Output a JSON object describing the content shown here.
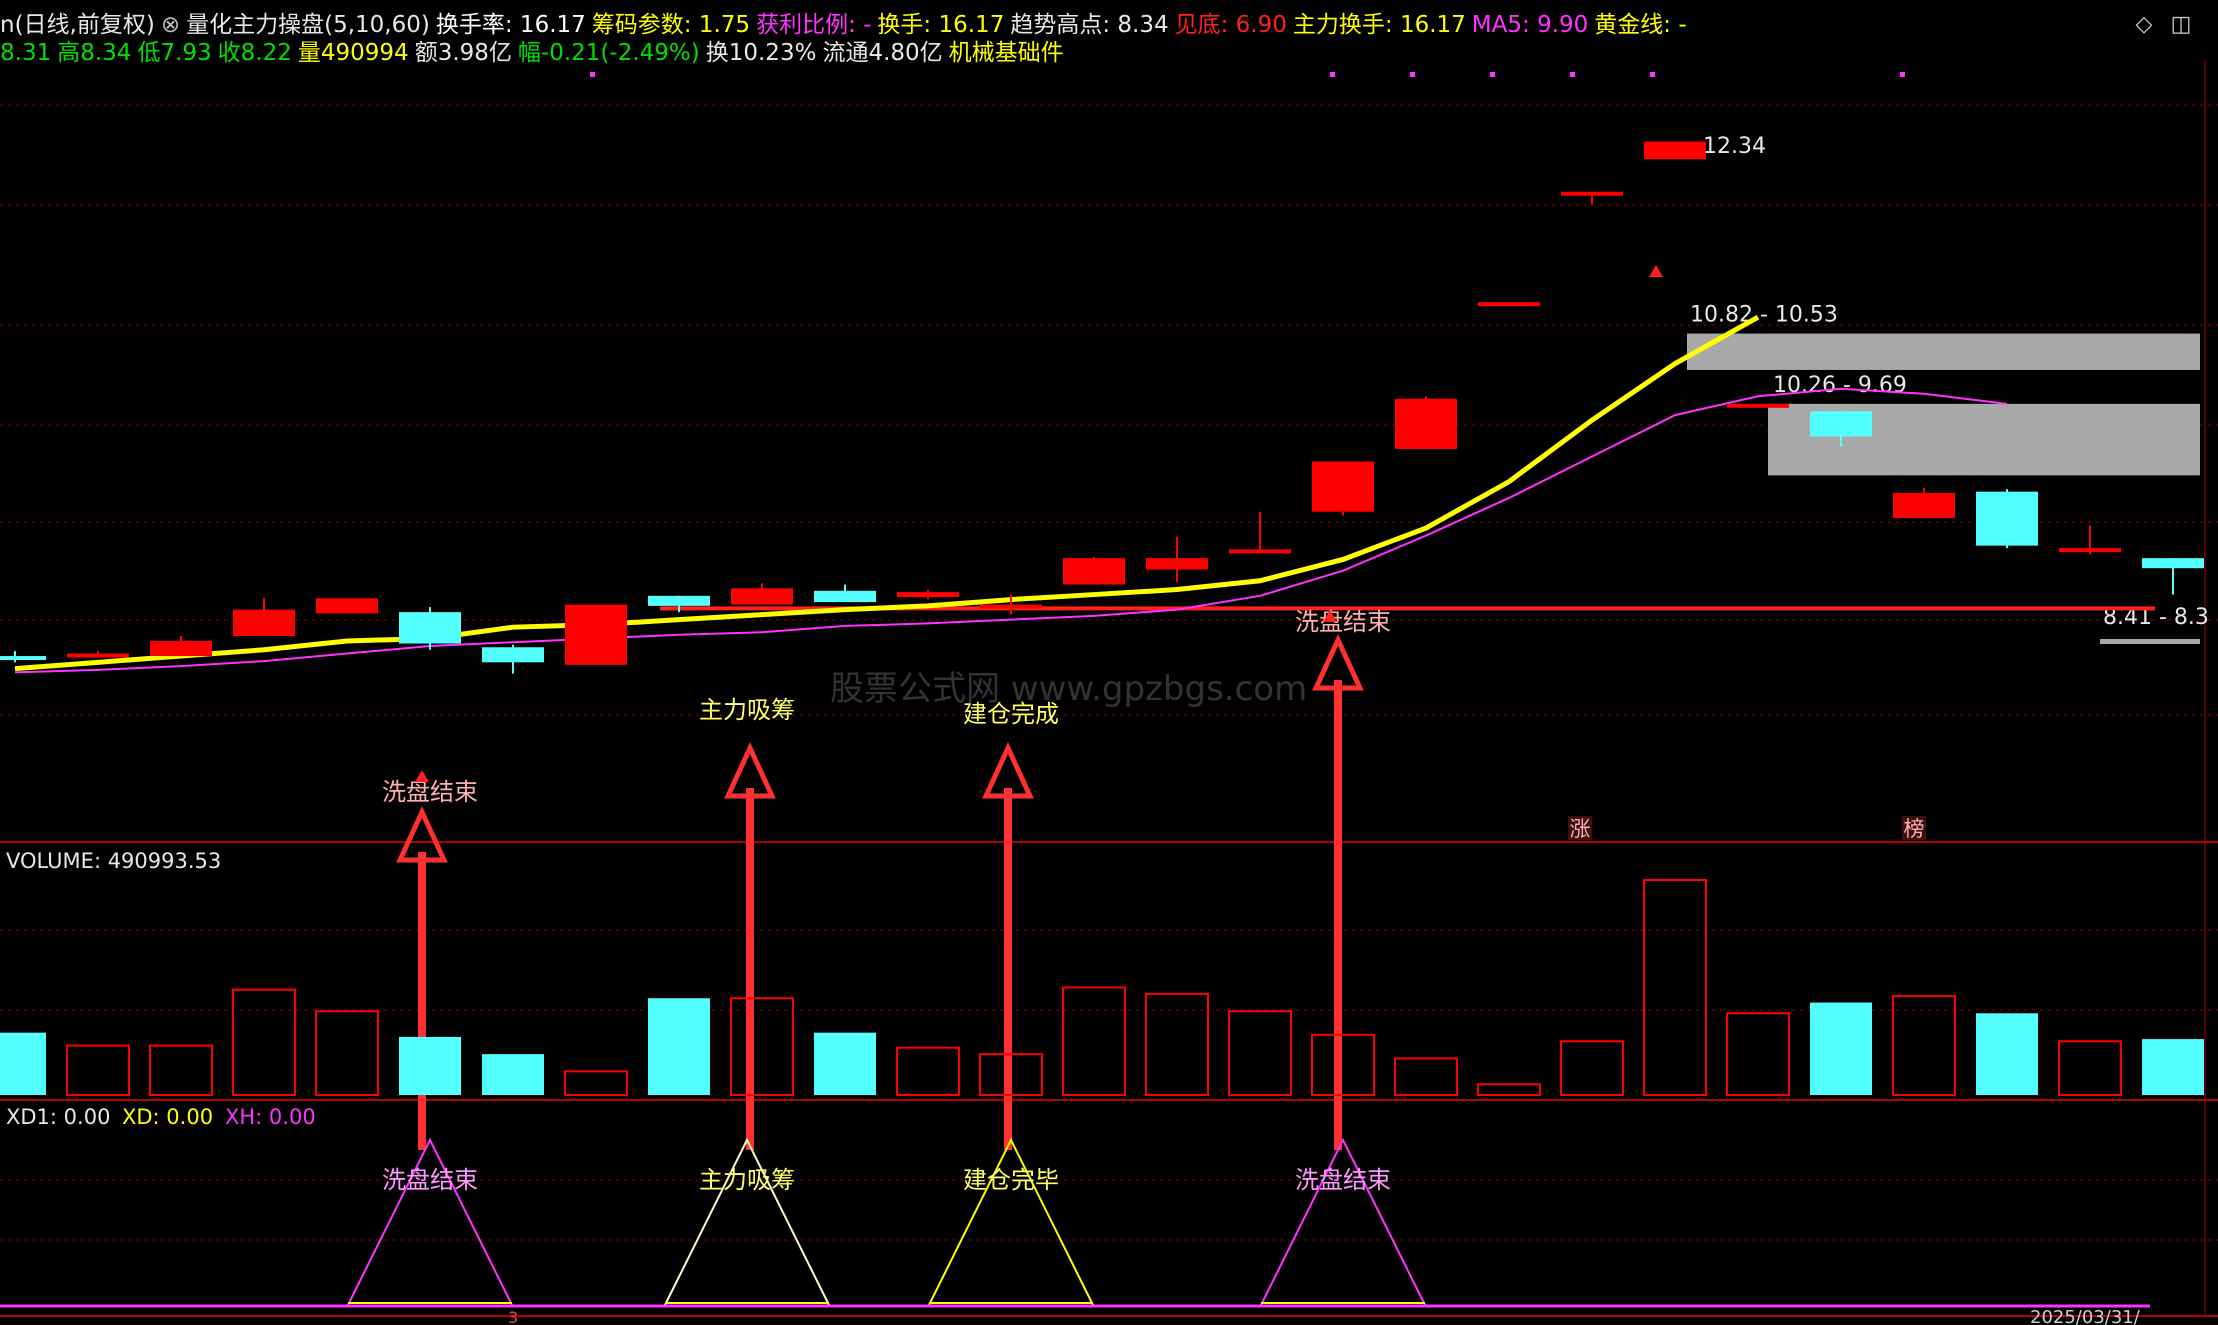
{
  "header": {
    "line1": [
      {
        "text": "n(日线,前复权)",
        "color": "#e8e8e8"
      },
      {
        "text": "⊗",
        "color": "#bbbbbb"
      },
      {
        "text": "量化主力操盘(5,10,60)",
        "color": "#e8e8e8"
      },
      {
        "text": "换手率: 16.17",
        "color": "#ffffff"
      },
      {
        "text": "筹码参数: 1.75",
        "color": "#ffff00"
      },
      {
        "text": "获利比例: -",
        "color": "#ff33ff"
      },
      {
        "text": "换手: 16.17",
        "color": "#ffff00"
      },
      {
        "text": "趋势高点: 8.34",
        "color": "#e8e8e8"
      },
      {
        "text": "见底: 6.90",
        "color": "#ff2020"
      },
      {
        "text": "主力换手: 16.17",
        "color": "#ffff00"
      },
      {
        "text": "MA5: 9.90",
        "color": "#ff33ff"
      },
      {
        "text": "黄金线: -",
        "color": "#ffff00"
      }
    ],
    "line2": [
      {
        "text": "8.31",
        "color": "#00e000"
      },
      {
        "text": "高8.34",
        "color": "#00e000"
      },
      {
        "text": "低7.93",
        "color": "#00e000"
      },
      {
        "text": "收8.22",
        "color": "#00e000"
      },
      {
        "text": "量490994",
        "color": "#ffff00"
      },
      {
        "text": "额3.98亿",
        "color": "#e8e8e8"
      },
      {
        "text": "幅-0.21(-2.49%)",
        "color": "#00e000"
      },
      {
        "text": "换10.23%",
        "color": "#e8e8e8"
      },
      {
        "text": "流通4.80亿",
        "color": "#e8e8e8"
      },
      {
        "text": "机械基础件",
        "color": "#ffff00"
      }
    ]
  },
  "window_icons": {
    "restore": "diamond-icon",
    "maximize": "window-icon"
  },
  "colors": {
    "up": "#ff0000",
    "down": "#54ffff",
    "ma_fast": "#ffff00",
    "ma_slow": "#ff33ff",
    "grid": "#8b0000",
    "separator": "#b00000"
  },
  "chart_data": {
    "type": "candlestick",
    "price_axis": {
      "ylim": [
        6.8,
        13.0
      ]
    },
    "candles": [
      {
        "o": 8.25,
        "h": 8.29,
        "l": 8.2,
        "c": 8.22
      },
      {
        "o": 8.27,
        "h": 8.29,
        "l": 8.25,
        "c": 8.27
      },
      {
        "o": 8.25,
        "h": 8.41,
        "l": 8.25,
        "c": 8.37
      },
      {
        "o": 8.41,
        "h": 8.71,
        "l": 8.41,
        "c": 8.62
      },
      {
        "o": 8.59,
        "h": 8.71,
        "l": 8.59,
        "c": 8.71
      },
      {
        "o": 8.6,
        "h": 8.64,
        "l": 8.3,
        "c": 8.35
      },
      {
        "o": 8.32,
        "h": 8.34,
        "l": 8.11,
        "c": 8.2
      },
      {
        "o": 8.18,
        "h": 8.66,
        "l": 8.18,
        "c": 8.66
      },
      {
        "o": 8.73,
        "h": 8.73,
        "l": 8.6,
        "c": 8.65
      },
      {
        "o": 8.66,
        "h": 8.83,
        "l": 8.66,
        "c": 8.79
      },
      {
        "o": 8.77,
        "h": 8.82,
        "l": 8.68,
        "c": 8.68
      },
      {
        "o": 8.72,
        "h": 8.78,
        "l": 8.7,
        "c": 8.76
      },
      {
        "o": 8.64,
        "h": 8.74,
        "l": 8.58,
        "c": 8.66
      },
      {
        "o": 8.82,
        "h": 9.04,
        "l": 8.82,
        "c": 9.03
      },
      {
        "o": 8.94,
        "h": 9.2,
        "l": 8.84,
        "c": 9.03
      },
      {
        "o": 9.09,
        "h": 9.4,
        "l": 9.07,
        "c": 9.1
      },
      {
        "o": 9.4,
        "h": 9.4,
        "l": 9.37,
        "c": 9.8
      },
      {
        "o": 9.9,
        "h": 10.32,
        "l": 10.03,
        "c": 10.3
      },
      {
        "o": 11.07,
        "h": 11.07,
        "l": 11.07,
        "c": 11.07
      },
      {
        "o": 11.95,
        "h": 11.95,
        "l": 11.85,
        "c": 11.95
      },
      {
        "o": 12.21,
        "h": 12.34,
        "l": 12.21,
        "c": 12.35
      },
      {
        "o": 10.26,
        "h": 10.26,
        "l": 10.26,
        "c": 10.26
      },
      {
        "o": 10.2,
        "h": 10.2,
        "l": 9.92,
        "c": 10.0
      },
      {
        "o": 9.35,
        "h": 9.59,
        "l": 9.35,
        "c": 9.55
      },
      {
        "o": 9.56,
        "h": 9.58,
        "l": 9.11,
        "c": 9.13
      },
      {
        "o": 9.08,
        "h": 9.29,
        "l": 9.06,
        "c": 9.11
      },
      {
        "o": 9.03,
        "h": 9.03,
        "l": 8.74,
        "c": 8.95
      }
    ],
    "ma_fast": [
      8.15,
      8.2,
      8.25,
      8.3,
      8.37,
      8.39,
      8.48,
      8.5,
      8.54,
      8.58,
      8.62,
      8.65,
      8.7,
      8.74,
      8.78,
      8.85,
      9.02,
      9.27,
      9.64,
      10.13,
      10.58,
      10.95
    ],
    "ma_slow": [
      8.12,
      8.14,
      8.17,
      8.21,
      8.27,
      8.33,
      8.36,
      8.39,
      8.42,
      8.44,
      8.49,
      8.51,
      8.54,
      8.57,
      8.62,
      8.73,
      8.93,
      9.21,
      9.51,
      9.84,
      10.17,
      10.32,
      10.38,
      10.34,
      10.26
    ],
    "support_line": 8.63,
    "zones": [
      {
        "label": "10.82 - 10.53",
        "top": 10.82,
        "bottom": 10.53
      },
      {
        "label": "10.26 - 9.69",
        "top": 10.26,
        "bottom": 9.69
      },
      {
        "label": "8.41 - 8.3",
        "top": 8.41,
        "bottom": 8.3
      }
    ],
    "price_labels": [
      {
        "text": "12.34"
      }
    ],
    "signal_labels": [
      {
        "text": "洗盘结束",
        "bar": 5,
        "color": "#ffb0b0"
      },
      {
        "text": "主力吸筹",
        "bar": 9,
        "color": "#ffff66"
      },
      {
        "text": "建仓完成",
        "bar": 12,
        "color": "#ffff66"
      },
      {
        "text": "洗盘结束",
        "bar": 16,
        "color": "#ffb0b0"
      }
    ],
    "badges": [
      {
        "text": "涨",
        "bar": 19
      },
      {
        "text": "榜",
        "bar": 23
      }
    ],
    "watermark": "股票公式网 www.gpzbgs.com",
    "volume": {
      "title": "VOLUME: 490993.53",
      "max": 1000000,
      "values": [
        290000,
        230000,
        230000,
        490000,
        390000,
        270000,
        190000,
        110000,
        450000,
        450000,
        290000,
        220000,
        190000,
        500000,
        470000,
        390000,
        280000,
        170000,
        50000,
        250000,
        1000000,
        380000,
        430000,
        460000,
        380000,
        250000,
        260000
      ]
    },
    "indicator": {
      "labels": [
        {
          "text": "XD1: 0.00",
          "color": "#e8e8e8"
        },
        {
          "text": "XD: 0.00",
          "color": "#ffff00"
        },
        {
          "text": "XH: 0.00",
          "color": "#ff33ff"
        }
      ],
      "peaks": [
        {
          "bar": 5,
          "text": "洗盘结束",
          "color": "#ff33ff"
        },
        {
          "bar": 9,
          "text": "主力吸筹",
          "color": "#ffffcc"
        },
        {
          "bar": 12,
          "text": "建仓完毕",
          "color": "#ffff00"
        },
        {
          "bar": 16,
          "text": "洗盘结束",
          "color": "#ff33ff"
        }
      ]
    },
    "footer": {
      "date_label": "2025/03/31/",
      "tick_label": "3"
    }
  }
}
